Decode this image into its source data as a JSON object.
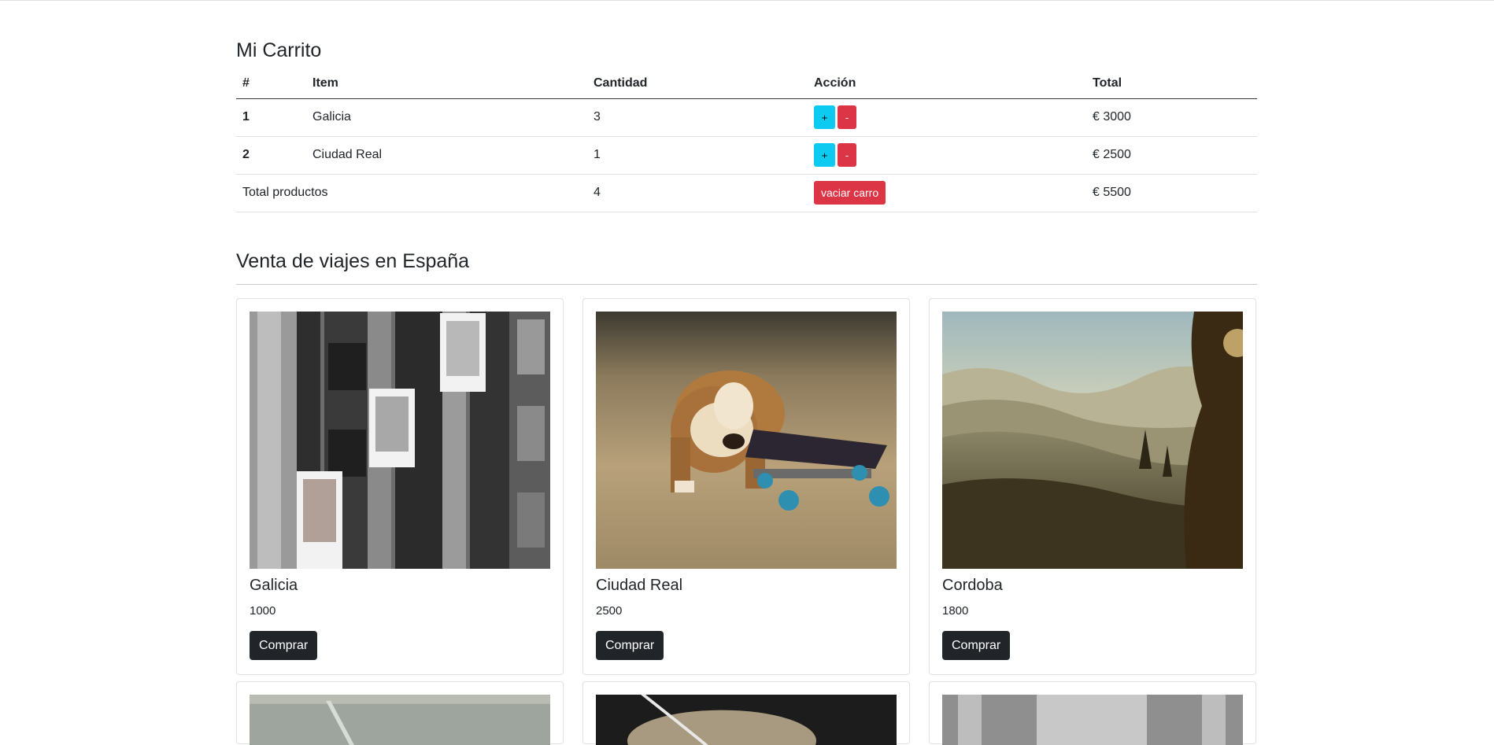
{
  "cart": {
    "title": "Mi Carrito",
    "headers": [
      "#",
      "Item",
      "Cantidad",
      "Acción",
      "Total"
    ],
    "rows": [
      {
        "num": "1",
        "item": "Galicia",
        "qty": "3",
        "total": "€ 3000"
      },
      {
        "num": "2",
        "item": "Ciudad Real",
        "qty": "1",
        "total": "€ 2500"
      }
    ],
    "add_label": "+",
    "remove_label": "-",
    "footer": {
      "label": "Total productos",
      "qty": "4",
      "clear_label": "vaciar carro",
      "total": "€ 5500"
    }
  },
  "shop": {
    "title": "Venta de viajes en España",
    "buy_label": "Comprar",
    "products": [
      {
        "name": "Galicia",
        "price": "1000",
        "image": "elevator-building-photo"
      },
      {
        "name": "Ciudad Real",
        "price": "2500",
        "image": "bulldog-puppy-skateboard-photo"
      },
      {
        "name": "Cordoba",
        "price": "1800",
        "image": "misty-valley-landscape-photo"
      }
    ],
    "partial_images": [
      "cracked-wall-photo",
      "desk-cables-photo",
      "colonnade-ceiling-photo"
    ]
  },
  "colors": {
    "info": "#0dcaf0",
    "danger": "#dc3545",
    "dark": "#212529"
  }
}
